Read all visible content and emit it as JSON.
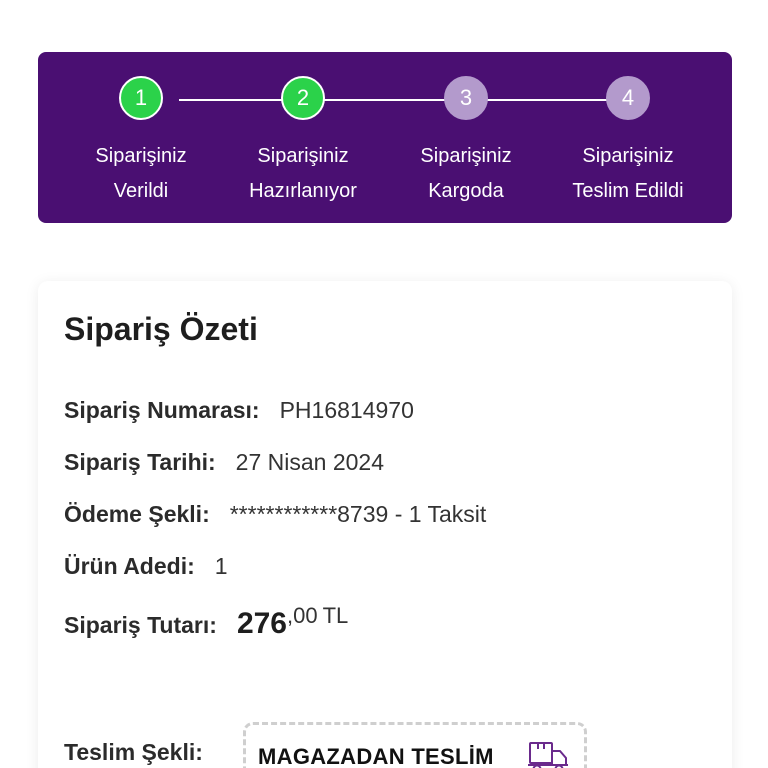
{
  "steps": [
    {
      "number": "1",
      "line1": "Siparişiniz",
      "line2": "Verildi",
      "status": "done"
    },
    {
      "number": "2",
      "line1": "Siparişiniz",
      "line2": "Hazırlanıyor",
      "status": "done"
    },
    {
      "number": "3",
      "line1": "Siparişiniz",
      "line2": "Kargoda",
      "status": "todo"
    },
    {
      "number": "4",
      "line1": "Siparişiniz",
      "line2": "Teslim Edildi",
      "status": "todo"
    }
  ],
  "summary": {
    "title": "Sipariş Özeti",
    "order_number_label": "Sipariş Numarası:",
    "order_number": "PH16814970",
    "order_date_label": "Sipariş Tarihi:",
    "order_date": "27 Nisan 2024",
    "payment_label": "Ödeme Şekli:",
    "payment": "************8739 - 1 Taksit",
    "quantity_label": "Ürün Adedi:",
    "quantity": "1",
    "total_label": "Sipariş Tutarı:",
    "total_integer": "276",
    "total_decimal": ",00",
    "total_currency": "TL",
    "delivery_label": "Teslim Şekli:",
    "delivery_method": "MAGAZADAN TESLİM"
  },
  "colors": {
    "tracker_bg": "#4a0f72",
    "step_done": "#2bd24a",
    "step_todo": "#b39acc",
    "icon_accent": "#6a2a8c"
  },
  "icons": {
    "delivery": "store-delivery-truck-icon"
  }
}
